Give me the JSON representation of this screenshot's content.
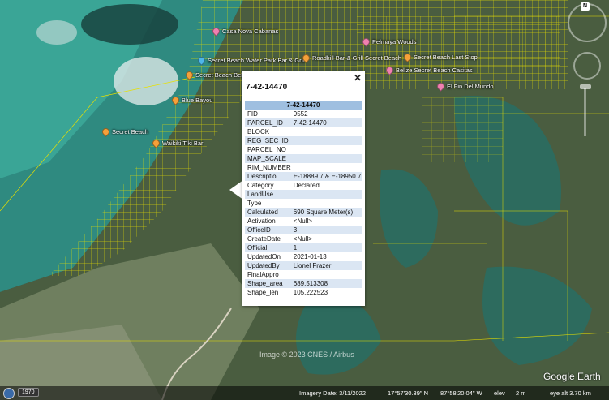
{
  "map": {
    "places": [
      {
        "name": "Casa Nova Cabanas",
        "color": "pink"
      },
      {
        "name": "Secret Beach Water Park Bar & Grill",
        "color": "blue"
      },
      {
        "name": "Secret Beach Bel",
        "color": "orange"
      },
      {
        "name": "Blue Bayou",
        "color": "orange"
      },
      {
        "name": "Secret Beach",
        "color": "orange"
      },
      {
        "name": "Waikiki Tiki Bar",
        "color": "orange"
      },
      {
        "name": "Pelmaya Woods",
        "color": "pink"
      },
      {
        "name": "Roadkill Bar & Grill Secret Beach",
        "color": "orange"
      },
      {
        "name": "Secret Beach Last Stop",
        "color": "orange"
      },
      {
        "name": "Belize Secret Beach Casitas",
        "color": "pink"
      },
      {
        "name": "El Fin Del Mundo",
        "color": "pink"
      }
    ],
    "copyright": "Image © 2023 CNES / Airbus",
    "logo": "Google Earth",
    "compass_label": "N"
  },
  "popup": {
    "title": "7-42-14470",
    "close": "✕",
    "table_header": "7-42-14470",
    "rows": [
      {
        "k": "FID",
        "v": "9552"
      },
      {
        "k": "PARCEL_ID",
        "v": "7-42-14470"
      },
      {
        "k": "BLOCK",
        "v": ""
      },
      {
        "k": "REG_SEC_ID",
        "v": ""
      },
      {
        "k": "PARCEL_NO",
        "v": ""
      },
      {
        "k": "MAP_SCALE",
        "v": ""
      },
      {
        "k": "RIM_NUMBER",
        "v": ""
      },
      {
        "k": "Descriptio",
        "v": "E-18889 7 & E-18950 7"
      },
      {
        "k": "Category",
        "v": "Declared"
      },
      {
        "k": "LandUse",
        "v": ""
      },
      {
        "k": "Type",
        "v": ""
      },
      {
        "k": "Calculated",
        "v": "690 Square Meter(s)"
      },
      {
        "k": "Activation",
        "v": "<Null>"
      },
      {
        "k": "OfficeID",
        "v": "3"
      },
      {
        "k": "CreateDate",
        "v": "<Null>"
      },
      {
        "k": "Official",
        "v": "1"
      },
      {
        "k": "UpdatedOn",
        "v": "2021-01-13"
      },
      {
        "k": "UpdatedBy",
        "v": "Lionel Frazer"
      },
      {
        "k": "FinalAppro",
        "v": ""
      },
      {
        "k": "Shape_area",
        "v": "689.513308"
      },
      {
        "k": "Shape_len",
        "v": "105.222523"
      }
    ]
  },
  "status": {
    "year": "1970",
    "imagery_date": "Imagery Date: 3/11/2022",
    "lat": "17°57'30.39\" N",
    "lon": "87°58'20.04\" W",
    "elev_label": "elev",
    "elev": "2 m",
    "eye_alt": "eye alt  3.70 km"
  }
}
